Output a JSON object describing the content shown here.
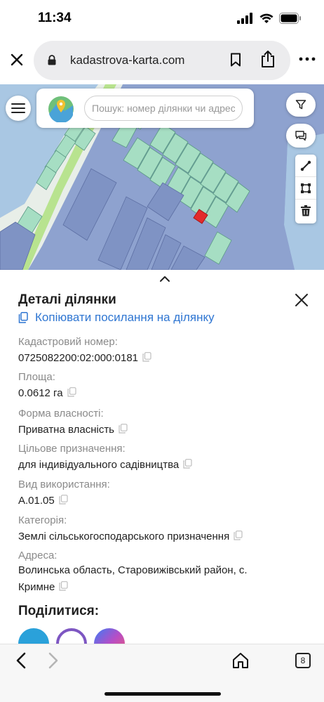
{
  "status_bar": {
    "time": "11:34"
  },
  "browser": {
    "url": "kadastrova-karta.com",
    "open_tabs_count": "8"
  },
  "map": {
    "search_placeholder": "Пошук: номер ділянки чи адресу",
    "colors": {
      "water": "#a9c7e3",
      "land": "#8ea2cf",
      "parcel_green": "#a6dec3",
      "parcel_blue": "#8ea2cf",
      "selected_parcel": "#e32b2b",
      "road": "#b8e38f"
    }
  },
  "details": {
    "title": "Деталі ділянки",
    "copy_link": "Копіювати посилання на ділянку",
    "fields": [
      {
        "label": "Кадастровий номер:",
        "value": "0725082200:02:000:0181"
      },
      {
        "label": "Площа:",
        "value": "0.0612 га"
      },
      {
        "label": "Форма власності:",
        "value": "Приватна власність"
      },
      {
        "label": "Цільове призначення:",
        "value": "для індивідуального садівництва"
      },
      {
        "label": "Вид використання:",
        "value": "A.01.05"
      },
      {
        "label": "Категорія:",
        "value": "Землі сільськогосподарського призначення"
      },
      {
        "label": "Адреса:",
        "value_line1": "Волинська область, Старовижівський район, с.",
        "value_line2": "Кримне"
      }
    ],
    "share_title": "Поділитися:",
    "share_icons": [
      "telegram-icon",
      "viber-icon",
      "messenger-icon"
    ],
    "share_colors": [
      "#2aa1da",
      "#7d56c2",
      "#b64ec6"
    ]
  }
}
